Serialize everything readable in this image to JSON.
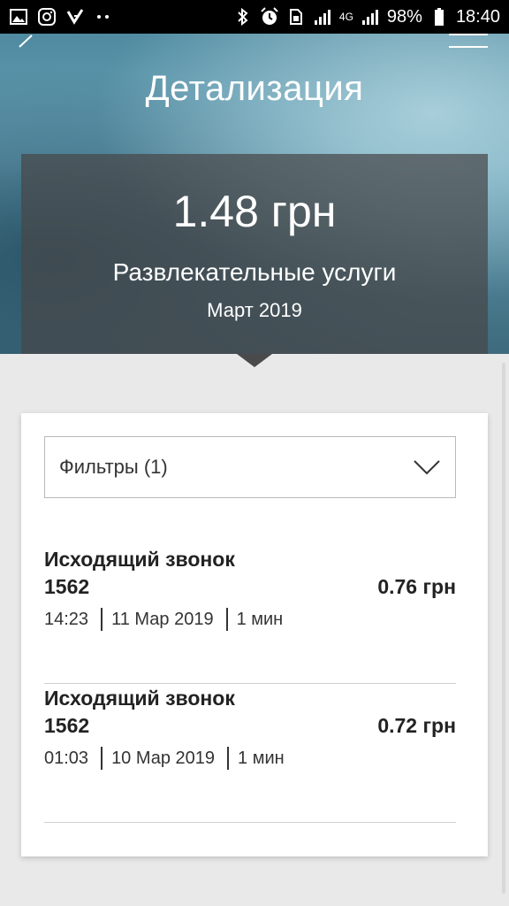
{
  "status_bar": {
    "battery": "98%",
    "time": "18:40",
    "network_type": "4G"
  },
  "header": {
    "title": "Детализация"
  },
  "summary": {
    "amount": "1.48 грн",
    "category": "Развлекательные услуги",
    "period": "Март 2019"
  },
  "filters": {
    "label": "Фильтры (1)"
  },
  "transactions": [
    {
      "title": "Исходящий звонок",
      "number": "1562",
      "amount": "0.76 грн",
      "time": "14:23",
      "date": "11 Мар 2019",
      "duration": "1 мин"
    },
    {
      "title": "Исходящий звонок",
      "number": "1562",
      "amount": "0.72 грн",
      "time": "01:03",
      "date": "10 Мар 2019",
      "duration": "1 мин"
    }
  ],
  "colors": {
    "status_bar_bg": "#000000",
    "panel_bg": "#464648",
    "page_bg": "#e9e9e9",
    "card_bg": "#ffffff",
    "text_dark": "#222222"
  }
}
